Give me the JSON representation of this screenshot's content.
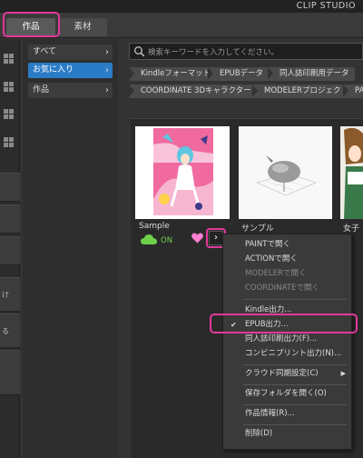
{
  "app": {
    "title": "CLIP STUDIO"
  },
  "tabs": [
    {
      "label": "作品"
    },
    {
      "label": "素材"
    }
  ],
  "strip": {
    "labels": [
      "け",
      "る"
    ]
  },
  "nav": {
    "items": [
      {
        "label": "すべて"
      },
      {
        "label": "お気に入り"
      },
      {
        "label": "作品"
      }
    ]
  },
  "search": {
    "placeholder": "検索キーワードを入力してください。"
  },
  "tags": [
    "Kindleフォーマット",
    "EPUBデータ",
    "同人誌印刷用データ",
    "COORDINATE 3Dキャラクター",
    "MODELERプロジェクト",
    "PA"
  ],
  "cards": [
    {
      "label": "Sample",
      "status": "ON"
    },
    {
      "label": "サンプル"
    },
    {
      "label": "女子学"
    }
  ],
  "context_menu": {
    "items": [
      {
        "label": "PAINTで開く",
        "disabled": false
      },
      {
        "label": "ACTIONで開く",
        "disabled": false
      },
      {
        "label": "MODELERで開く",
        "disabled": true
      },
      {
        "label": "COORDINATEで開く",
        "disabled": true
      },
      {
        "label": "Kindle出力...",
        "disabled": false
      },
      {
        "label": "EPUB出力...",
        "disabled": false,
        "checked": true
      },
      {
        "label": "同人誌印刷出力(F)...",
        "disabled": false
      },
      {
        "label": "コンビニプリント出力(N)...",
        "disabled": false
      },
      {
        "label": "クラウド同期設定(C)",
        "disabled": false,
        "submenu": true
      },
      {
        "label": "保存フォルダを開く(O)",
        "disabled": false
      },
      {
        "label": "作品情報(R)...",
        "disabled": false
      },
      {
        "label": "削除(D)",
        "disabled": false
      }
    ]
  },
  "colors": {
    "accent": "#2b7cc7",
    "highlight": "#e0399a",
    "on": "#6fd14a",
    "heart": "#ff7fd0"
  }
}
